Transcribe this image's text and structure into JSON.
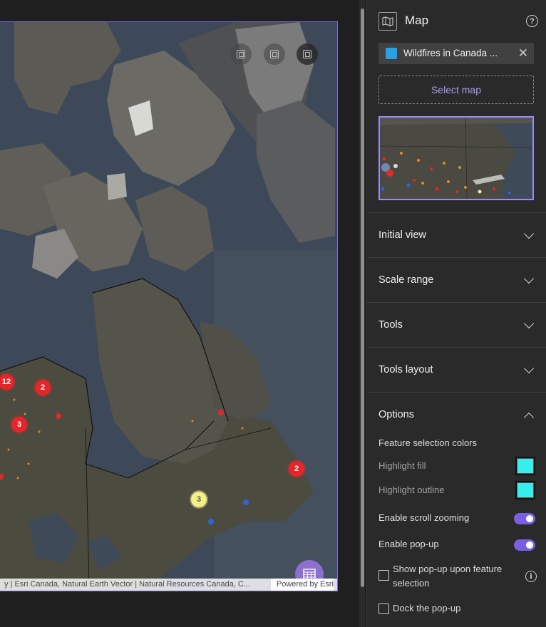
{
  "map": {
    "attribution": "y | Esri Canada, Natural Earth Vector | Natural Resources Canada, C...",
    "powered_by": "Powered by Esri",
    "clusters": [
      {
        "label": "12",
        "color": "red"
      },
      {
        "label": "2",
        "color": "red"
      },
      {
        "label": "3",
        "color": "red"
      },
      {
        "label": "2",
        "color": "red"
      },
      {
        "label": "3",
        "color": "yellow"
      }
    ]
  },
  "panel": {
    "title": "Map",
    "map_chip_label": "Wildfires in Canada ...",
    "select_map_label": "Select map",
    "sections": {
      "initial_view": "Initial view",
      "scale_range": "Scale range",
      "tools": "Tools",
      "tools_layout": "Tools layout",
      "options": "Options"
    },
    "options": {
      "feature_selection_colors": "Feature selection colors",
      "highlight_fill": "Highlight fill",
      "highlight_outline": "Highlight outline",
      "enable_scroll_zooming": "Enable scroll zooming",
      "enable_popup": "Enable pop-up",
      "show_popup_line1": "Show pop-up upon feature",
      "show_popup_line2": "selection",
      "dock_popup": "Dock the pop-up"
    },
    "states": {
      "enable_scroll_zooming": true,
      "enable_popup": true,
      "show_popup_upon_selection": false,
      "dock_popup": false
    }
  },
  "colors": {
    "accent": "#7a5fe2",
    "select_text": "#a99bf0",
    "highlight_fill": "#33f0ee",
    "highlight_outline": "#33f0ee",
    "cluster_red": "#e6252a",
    "cluster_yellow": "#f3f08a",
    "table_button": "#8c6fcf"
  },
  "icons": {
    "header": "map-icon",
    "help": "help-icon",
    "chip": "web-map-icon",
    "close": "close-icon",
    "table": "table-icon",
    "info": "info-icon"
  }
}
